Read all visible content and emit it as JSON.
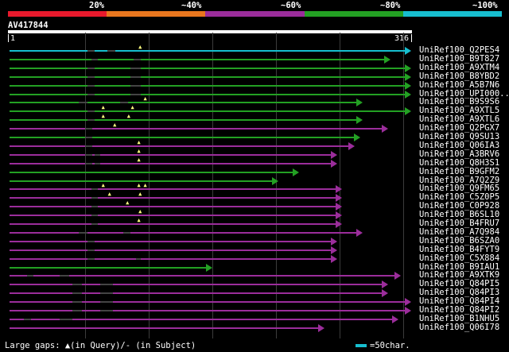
{
  "identity_legend": {
    "labels": [
      "20%",
      "~40%",
      "~60%",
      "~80%",
      "~100%"
    ],
    "colors": [
      "#e8192c",
      "#e8761e",
      "#9b2d9b",
      "#23a023",
      "#17becf"
    ]
  },
  "query": {
    "id": "AV417844",
    "ruler_start": "1",
    "ruler_end": "316"
  },
  "hits": [
    {
      "label": "UniRef100_Q2PES4",
      "color": "#17becf",
      "end": 316,
      "gaps": [
        [
          62,
          68
        ],
        [
          78,
          84
        ]
      ],
      "marks": [
        104
      ]
    },
    {
      "label": "UniRef100_B9T827",
      "color": "#23a023",
      "end": 300,
      "gaps": [
        [
          65,
          70
        ],
        [
          98,
          104
        ]
      ],
      "marks": []
    },
    {
      "label": "UniRef100_A9XTM4",
      "color": "#23a023",
      "end": 316,
      "gaps": [
        [
          62,
          68
        ],
        [
          96,
          104
        ]
      ],
      "marks": []
    },
    {
      "label": "UniRef100_B8YBD2",
      "color": "#23a023",
      "end": 316,
      "gaps": [
        [
          62,
          68
        ],
        [
          96,
          104
        ]
      ],
      "marks": []
    },
    {
      "label": "UniRef100_A5B7N6",
      "color": "#23a023",
      "end": 316,
      "gaps": [
        [
          62,
          68
        ],
        [
          96,
          104
        ]
      ],
      "marks": []
    },
    {
      "label": "UniRef100_UPI000...",
      "color": "#23a023",
      "end": 316,
      "gaps": [
        [
          62,
          68
        ],
        [
          96,
          104
        ]
      ],
      "marks": []
    },
    {
      "label": "UniRef100_B9S9S6",
      "color": "#23a023",
      "end": 278,
      "gaps": [
        [
          55,
          62
        ],
        [
          88,
          94
        ]
      ],
      "marks": [
        108
      ]
    },
    {
      "label": "UniRef100_A9XTL5",
      "color": "#23a023",
      "end": 316,
      "gaps": [
        [
          62,
          68
        ]
      ],
      "marks": [
        75,
        98
      ]
    },
    {
      "label": "UniRef100_A9XTL6",
      "color": "#23a023",
      "end": 278,
      "gaps": [
        [
          62,
          68
        ]
      ],
      "marks": [
        75,
        95
      ]
    },
    {
      "label": "UniRef100_Q2PGX7",
      "color": "#9b2d9b",
      "end": 298,
      "gaps": [
        [
          60,
          66
        ]
      ],
      "marks": [
        84
      ]
    },
    {
      "label": "UniRef100_Q9SU13",
      "color": "#23a023",
      "end": 276,
      "gaps": [
        [
          60,
          66
        ]
      ],
      "marks": []
    },
    {
      "label": "UniRef100_Q06IA3",
      "color": "#9b2d9b",
      "end": 272,
      "gaps": [
        [
          60,
          66
        ]
      ],
      "marks": [
        103
      ]
    },
    {
      "label": "UniRef100_A3BRV6",
      "color": "#9b2d9b",
      "end": 258,
      "gaps": [
        [
          60,
          66
        ],
        [
          68,
          72
        ]
      ],
      "marks": [
        103
      ]
    },
    {
      "label": "UniRef100_Q8H3S1",
      "color": "#9b2d9b",
      "end": 258,
      "gaps": [
        [
          60,
          66
        ],
        [
          68,
          72
        ]
      ],
      "marks": [
        103
      ]
    },
    {
      "label": "UniRef100_B9GFM2",
      "color": "#23a023",
      "end": 228,
      "gaps": [],
      "marks": []
    },
    {
      "label": "UniRef100_A7Q2Z9",
      "color": "#23a023",
      "end": 212,
      "gaps": [],
      "marks": []
    },
    {
      "label": "UniRef100_Q9FM65",
      "color": "#9b2d9b",
      "end": 262,
      "gaps": [
        [
          65,
          70
        ]
      ],
      "marks": [
        75,
        103,
        108
      ]
    },
    {
      "label": "UniRef100_C5Z0P5",
      "color": "#9b2d9b",
      "end": 262,
      "gaps": [
        [
          65,
          70
        ]
      ],
      "marks": [
        80,
        104
      ]
    },
    {
      "label": "UniRef100_C0P928",
      "color": "#9b2d9b",
      "end": 262,
      "gaps": [
        [
          65,
          70
        ]
      ],
      "marks": [
        94
      ]
    },
    {
      "label": "UniRef100_B6SL10",
      "color": "#9b2d9b",
      "end": 262,
      "gaps": [
        [
          65,
          70
        ]
      ],
      "marks": [
        104
      ]
    },
    {
      "label": "UniRef100_B4FRU7",
      "color": "#9b2d9b",
      "end": 262,
      "gaps": [
        [
          65,
          70
        ]
      ],
      "marks": [
        103
      ]
    },
    {
      "label": "UniRef100_A7Q984",
      "color": "#9b2d9b",
      "end": 278,
      "gaps": [
        [
          55,
          62
        ],
        [
          90,
          96
        ]
      ],
      "marks": []
    },
    {
      "label": "UniRef100_B6SZA0",
      "color": "#9b2d9b",
      "end": 258,
      "gaps": [
        [
          62,
          68
        ]
      ],
      "marks": []
    },
    {
      "label": "UniRef100_B4FYT9",
      "color": "#9b2d9b",
      "end": 258,
      "gaps": [
        [
          62,
          68
        ]
      ],
      "marks": []
    },
    {
      "label": "UniRef100_C5X884",
      "color": "#9b2d9b",
      "end": 258,
      "gaps": [
        [
          62,
          68
        ],
        [
          100,
          104
        ]
      ],
      "marks": []
    },
    {
      "label": "UniRef100_B9IAU1",
      "color": "#23a023",
      "end": 160,
      "gaps": [],
      "marks": []
    },
    {
      "label": "UniRef100_A9XTK9",
      "color": "#9b2d9b",
      "end": 308,
      "gaps": [
        [
          15,
          20
        ],
        [
          40,
          48
        ]
      ],
      "marks": []
    },
    {
      "label": "UniRef100_Q84PI5",
      "color": "#9b2d9b",
      "end": 298,
      "gaps": [
        [
          50,
          58
        ],
        [
          72,
          82
        ]
      ],
      "marks": []
    },
    {
      "label": "UniRef100_Q84PI3",
      "color": "#9b2d9b",
      "end": 298,
      "gaps": [
        [
          50,
          58
        ],
        [
          72,
          82
        ]
      ],
      "marks": []
    },
    {
      "label": "UniRef100_Q84PI4",
      "color": "#9b2d9b",
      "end": 316,
      "gaps": [
        [
          50,
          58
        ],
        [
          72,
          82
        ]
      ],
      "marks": []
    },
    {
      "label": "UniRef100_Q84PI2",
      "color": "#9b2d9b",
      "end": 316,
      "gaps": [
        [
          50,
          58
        ],
        [
          72,
          82
        ]
      ],
      "marks": []
    },
    {
      "label": "UniRef100_B1NHU5",
      "color": "#9b2d9b",
      "end": 306,
      "gaps": [
        [
          12,
          18
        ],
        [
          40,
          50
        ]
      ],
      "marks": []
    },
    {
      "label": "UniRef100_Q06I78",
      "color": "#9b2d9b",
      "end": 248,
      "gaps": [],
      "marks": []
    }
  ],
  "footer": {
    "gaps_text": "Large gaps: ▲(in Query)/- (in Subject)",
    "scale_text": "=50char."
  }
}
